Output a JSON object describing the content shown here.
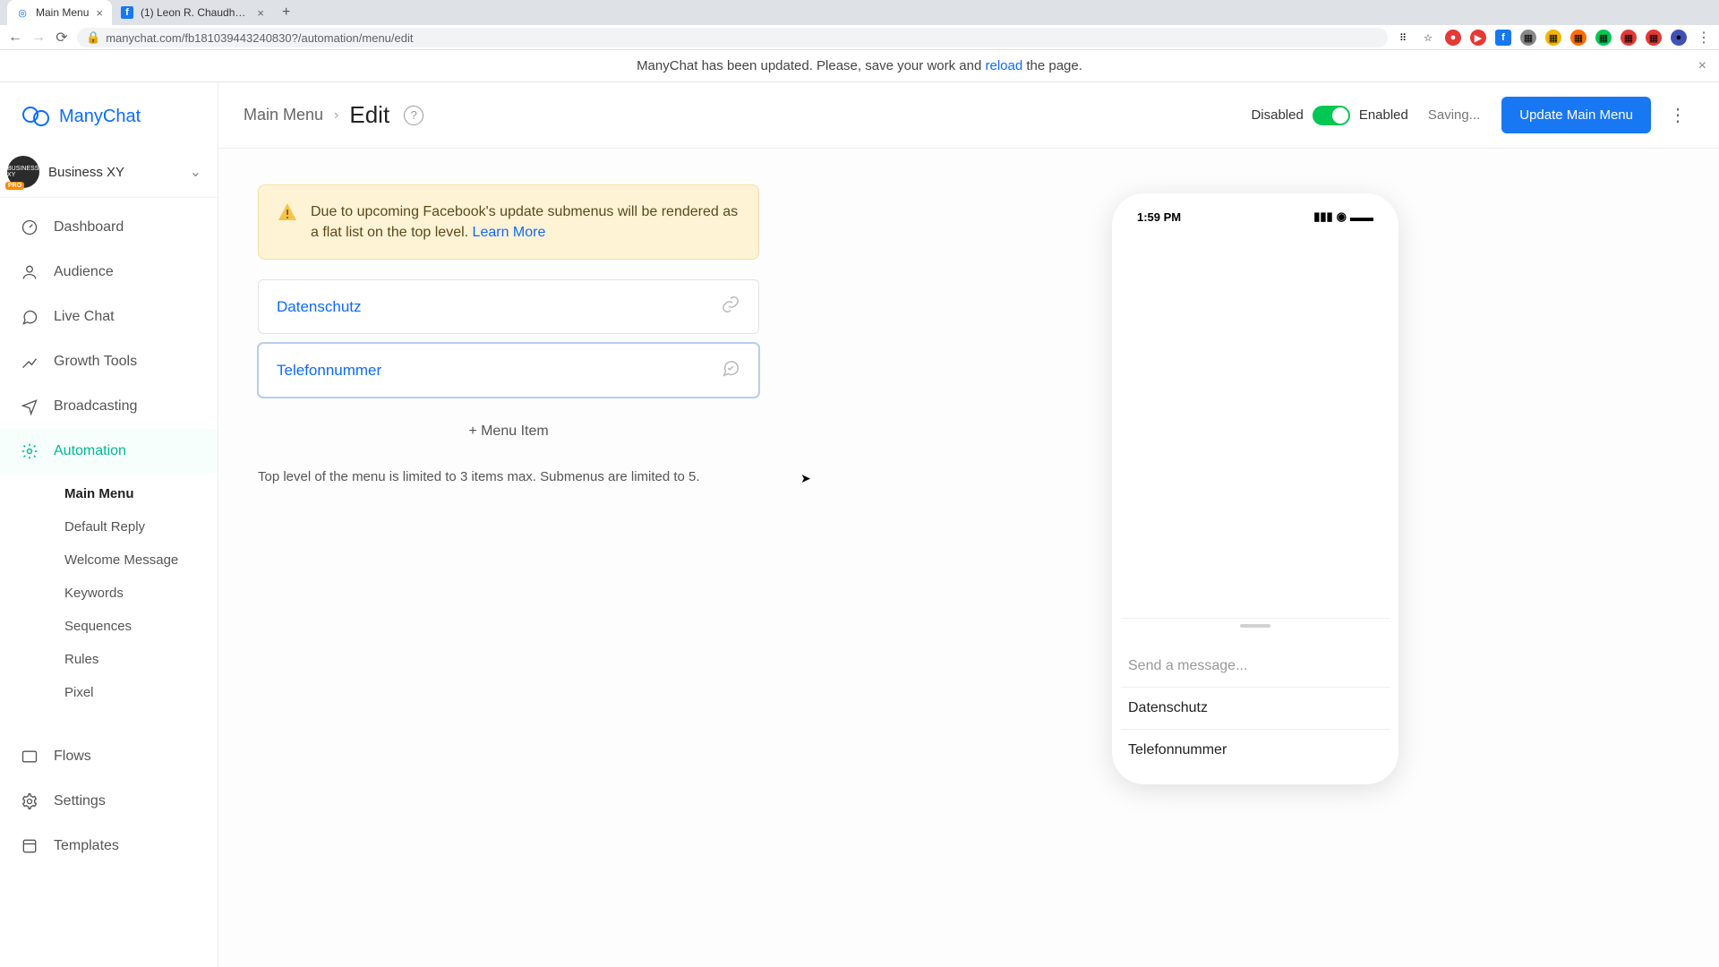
{
  "browser": {
    "tabs": [
      {
        "title": "Main Menu",
        "favicon_color": "#0a6bff"
      },
      {
        "title": "(1) Leon R. Chaudhari | Faceb",
        "favicon_color": "#1877f2"
      }
    ],
    "url": "manychat.com/fb181039443240830?/automation/menu/edit"
  },
  "banner": {
    "prefix": "ManyChat has been updated. Please, save your work and ",
    "link": "reload",
    "suffix": " the page."
  },
  "brand": {
    "name": "ManyChat"
  },
  "workspace": {
    "name": "Business XY",
    "badge": "PRO"
  },
  "nav": {
    "items": [
      "Dashboard",
      "Audience",
      "Live Chat",
      "Growth Tools",
      "Broadcasting",
      "Automation"
    ],
    "automation_sub": [
      "Main Menu",
      "Default Reply",
      "Welcome Message",
      "Keywords",
      "Sequences",
      "Rules",
      "Pixel"
    ],
    "bottom": [
      "Flows",
      "Settings",
      "Templates"
    ]
  },
  "header": {
    "breadcrumb": "Main Menu",
    "title": "Edit",
    "disabled": "Disabled",
    "enabled": "Enabled",
    "saving": "Saving...",
    "update_btn": "Update Main Menu"
  },
  "alert": {
    "text": "Due to upcoming Facebook's update submenus will be rendered as a flat list on the top level. ",
    "link": "Learn More"
  },
  "menu_items": [
    "Datenschutz",
    "Telefonnummer"
  ],
  "add_item": "+ Menu Item",
  "limit_text": "Top level of the menu is limited to 3 items max. Submenus are limited to 5.",
  "phone": {
    "time": "1:59 PM",
    "send_placeholder": "Send a message...",
    "drawer": [
      "Datenschutz",
      "Telefonnummer"
    ]
  }
}
